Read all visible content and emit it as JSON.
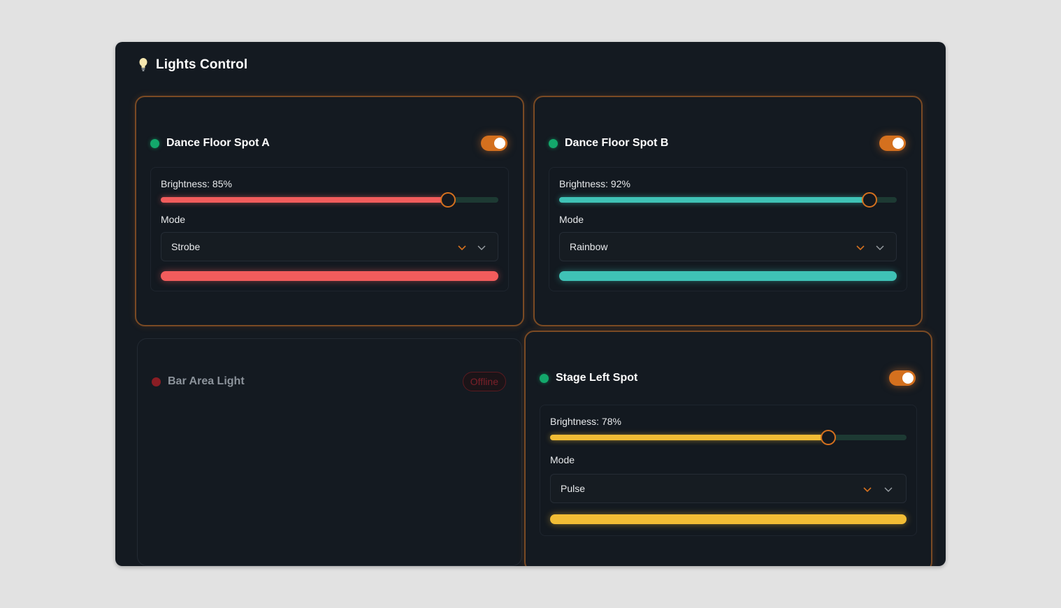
{
  "header": {
    "title": "Lights Control",
    "icon": "lightbulb-icon"
  },
  "colors": {
    "accent": "#d4701e",
    "online": "#13a86b",
    "offline": "#8a1d24"
  },
  "lights": [
    {
      "name": "Dance Floor Spot A",
      "status": "online",
      "power_on": true,
      "brightness_label": "Brightness: 85%",
      "brightness": 85,
      "mode_label": "Mode",
      "mode": "Strobe",
      "color": "#f25c5c"
    },
    {
      "name": "Dance Floor Spot B",
      "status": "online",
      "power_on": true,
      "brightness_label": "Brightness: 92%",
      "brightness": 92,
      "mode_label": "Mode",
      "mode": "Rainbow",
      "color": "#3fc2b6"
    },
    {
      "name": "Bar Area Light",
      "status": "offline",
      "badge": "Offline"
    },
    {
      "name": "Stage Left Spot",
      "status": "online",
      "power_on": true,
      "brightness_label": "Brightness: 78%",
      "brightness": 78,
      "mode_label": "Mode",
      "mode": "Pulse",
      "color": "#f2bd35"
    }
  ]
}
